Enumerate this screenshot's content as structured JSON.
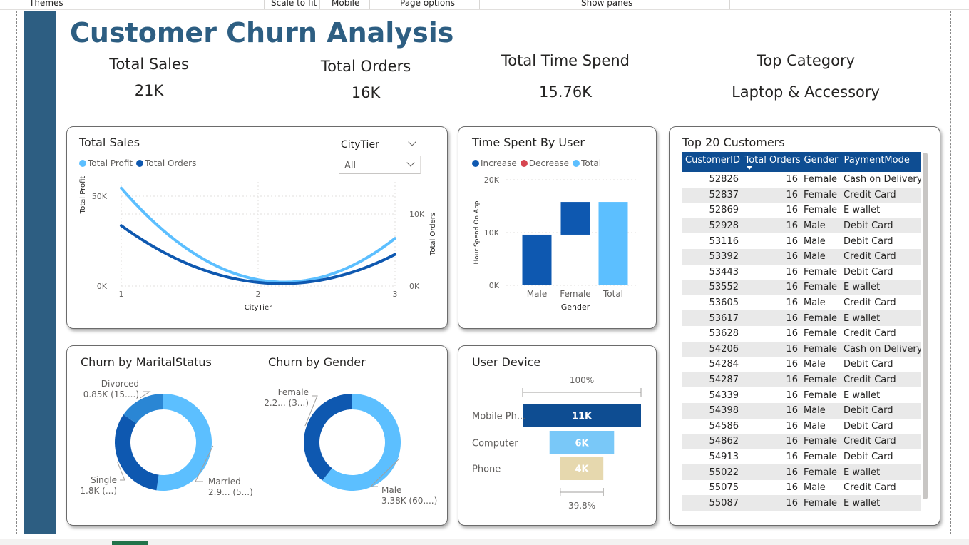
{
  "menu": {
    "items": [
      "Themes",
      "Scale to fit",
      "Mobile",
      "Page options",
      "Show panes"
    ]
  },
  "page_title": "Customer Churn Analysis",
  "kpis": [
    {
      "label": "Total Sales",
      "value": "21K"
    },
    {
      "label": "Total Orders",
      "value": "16K"
    },
    {
      "label": "Total Time Spend",
      "value": "15.76K"
    },
    {
      "label": "Top Category",
      "value": "Laptop & Accessory"
    }
  ],
  "colors": {
    "brand": "#2d5e82",
    "light_blue": "#5cbfff",
    "dark_blue": "#0e58b0",
    "navy": "#0e4d92",
    "decrease": "#d64550",
    "tan": "#e6d8ae",
    "sky": "#79c8f8"
  },
  "sales_card": {
    "title": "Total Sales",
    "slicer_title": "CityTier",
    "slicer_value": "All"
  },
  "time_card": {
    "title": "Time Spent By User"
  },
  "churn_card": {
    "title_marital": "Churn by MaritalStatus",
    "title_gender": "Churn by Gender"
  },
  "device_card": {
    "title": "User Device"
  },
  "table_card": {
    "title": "Top 20 Customers"
  },
  "chart_data": [
    {
      "type": "line",
      "title": "Total Sales",
      "xlabel": "CityTier",
      "ylabel": "Total Profit",
      "y2label": "Total Orders",
      "x": [
        "1",
        "2",
        "3"
      ],
      "ylim": [
        0,
        50000
      ],
      "y_ticks": [
        "0K",
        "50K"
      ],
      "y2lim": [
        0,
        10000
      ],
      "y2_ticks": [
        "0K",
        "10K"
      ],
      "legend_position": "top-left",
      "series": [
        {
          "name": "Total Profit",
          "axis": "left",
          "values": [
            54500,
            3500,
            26500
          ],
          "color": "#5cbfff"
        },
        {
          "name": "Total Orders",
          "axis": "right",
          "values": [
            8400,
            500,
            4400
          ],
          "color": "#0e58b0"
        }
      ]
    },
    {
      "type": "bar",
      "subtype": "waterfall",
      "title": "Time Spent By User",
      "xlabel": "Gender",
      "ylabel": "Hour Spend On App",
      "categories": [
        "Male",
        "Female",
        "Total"
      ],
      "ylim": [
        0,
        20000
      ],
      "y_ticks": [
        "0K",
        "10K",
        "20K"
      ],
      "legend": [
        "Increase",
        "Decrease",
        "Total"
      ],
      "legend_position": "top-left",
      "bars": [
        {
          "category": "Male",
          "start": 0,
          "end": 9600,
          "kind": "increase"
        },
        {
          "category": "Female",
          "start": 9600,
          "end": 15800,
          "kind": "increase"
        },
        {
          "category": "Total",
          "start": 0,
          "end": 15800,
          "kind": "total"
        }
      ]
    },
    {
      "type": "pie",
      "subtype": "donut",
      "title": "Churn by MaritalStatus",
      "slices": [
        {
          "name": "Married",
          "value": 2.9,
          "label1": "Married",
          "label2": "2.9... (5...)",
          "color": "#5cbfff"
        },
        {
          "name": "Single",
          "value": 1.8,
          "label1": "Single",
          "label2": "1.8K (...)",
          "color": "#0e58b0"
        },
        {
          "name": "Divorced",
          "value": 0.85,
          "label1": "Divorced",
          "label2": "0.85K (15....)",
          "color": "#2a86d4"
        }
      ]
    },
    {
      "type": "pie",
      "subtype": "donut",
      "title": "Churn by Gender",
      "slices": [
        {
          "name": "Male",
          "value": 3.38,
          "label1": "Male",
          "label2": "3.38K (60....)",
          "color": "#5cbfff"
        },
        {
          "name": "Female",
          "value": 2.2,
          "label1": "Female",
          "label2": "2.2... (3...)",
          "color": "#0e58b0"
        }
      ]
    },
    {
      "type": "bar",
      "subtype": "funnel",
      "title": "User Device",
      "top_percent": "100%",
      "bottom_percent": "39.8%",
      "categories": [
        "Mobile Ph...",
        "Computer",
        "Phone"
      ],
      "values": [
        11000,
        6000,
        4000
      ],
      "labels": [
        "11K",
        "6K",
        "4K"
      ],
      "colors": [
        "#0e4d92",
        "#79c8f8",
        "#e6d8ae"
      ]
    },
    {
      "type": "table",
      "title": "Top 20 Customers",
      "columns": [
        "CustomerID",
        "Total Orders",
        "Gender",
        "PaymentMode"
      ],
      "rows": [
        [
          "52826",
          "16",
          "Female",
          "Cash on Delivery"
        ],
        [
          "52837",
          "16",
          "Female",
          "Credit Card"
        ],
        [
          "52869",
          "16",
          "Female",
          "E wallet"
        ],
        [
          "52928",
          "16",
          "Male",
          "Debit Card"
        ],
        [
          "53116",
          "16",
          "Male",
          "Debit Card"
        ],
        [
          "53392",
          "16",
          "Male",
          "Credit Card"
        ],
        [
          "53443",
          "16",
          "Female",
          "Debit Card"
        ],
        [
          "53552",
          "16",
          "Female",
          "E wallet"
        ],
        [
          "53605",
          "16",
          "Male",
          "Credit Card"
        ],
        [
          "53617",
          "16",
          "Female",
          "E wallet"
        ],
        [
          "53628",
          "16",
          "Female",
          "Credit Card"
        ],
        [
          "54206",
          "16",
          "Female",
          "Cash on Delivery"
        ],
        [
          "54284",
          "16",
          "Male",
          "Debit Card"
        ],
        [
          "54287",
          "16",
          "Female",
          "Credit Card"
        ],
        [
          "54339",
          "16",
          "Female",
          "E wallet"
        ],
        [
          "54398",
          "16",
          "Male",
          "Debit Card"
        ],
        [
          "54586",
          "16",
          "Male",
          "Debit Card"
        ],
        [
          "54862",
          "16",
          "Female",
          "Credit Card"
        ],
        [
          "54913",
          "16",
          "Female",
          "Debit Card"
        ],
        [
          "55022",
          "16",
          "Female",
          "E wallet"
        ],
        [
          "55075",
          "16",
          "Male",
          "Credit Card"
        ],
        [
          "55087",
          "16",
          "Female",
          "E wallet"
        ]
      ]
    }
  ]
}
